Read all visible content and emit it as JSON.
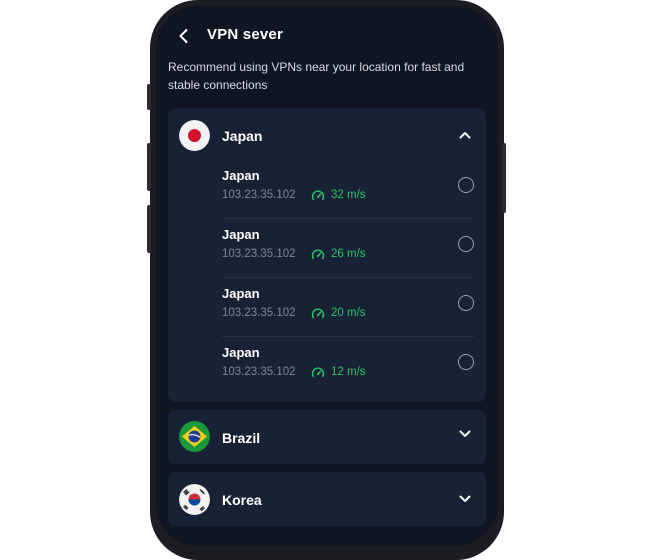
{
  "header": {
    "title": "VPN sever"
  },
  "subtitle": "Recommend using VPNs near your location for fast and stable connections",
  "countries": [
    {
      "name": "Japan",
      "expanded": true,
      "servers": [
        {
          "name": "Japan",
          "ip": "103.23.35.102",
          "speed": "32 m/s"
        },
        {
          "name": "Japan",
          "ip": "103.23.35.102",
          "speed": "26 m/s"
        },
        {
          "name": "Japan",
          "ip": "103.23.35.102",
          "speed": "20 m/s"
        },
        {
          "name": "Japan",
          "ip": "103.23.35.102",
          "speed": "12 m/s"
        }
      ]
    },
    {
      "name": "Brazil",
      "expanded": false
    },
    {
      "name": "Korea",
      "expanded": false
    }
  ],
  "colors": {
    "background": "#0f1622",
    "card": "#182235",
    "speed_green": "#27c46b",
    "muted_text": "#7e8696"
  },
  "icons": {
    "back": "chevron-left-icon",
    "expanded": "chevron-up-icon",
    "collapsed": "chevron-down-icon",
    "speed": "speedometer-icon",
    "select": "radio-icon"
  }
}
